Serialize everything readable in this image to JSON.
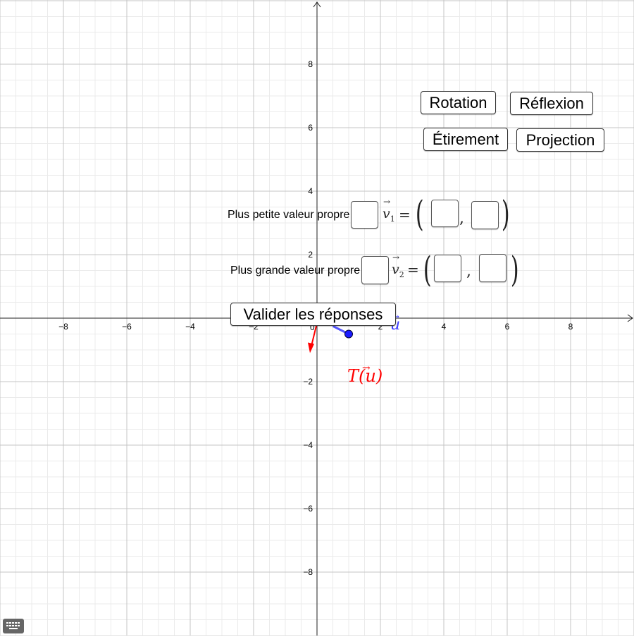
{
  "graph": {
    "x_range": [
      -10,
      10
    ],
    "y_range": [
      -10,
      10
    ],
    "x_ticks": [
      "−8",
      "−6",
      "−4",
      "−2",
      "2",
      "4",
      "6",
      "8"
    ],
    "y_ticks": [
      "8",
      "6",
      "4",
      "2",
      "−2",
      "−4",
      "−6",
      "−8"
    ],
    "origin_label": "0",
    "vector_u": {
      "end": [
        1,
        -0.5
      ],
      "label": "u",
      "color": "#3b3bff"
    },
    "vector_Tu": {
      "end": [
        -0.2,
        -1.1
      ],
      "label": "T(u)",
      "color": "#ff0000"
    },
    "grid": true
  },
  "buttons": {
    "rotation": "Rotation",
    "reflexion": "Réflexion",
    "etirement": "Étirement",
    "projection": "Projection",
    "valider": "Valider les réponses"
  },
  "rows": {
    "smallest_label": "Plus petite valeur propre",
    "largest_label": "Plus grande valeur propre",
    "v1_symbol": "v",
    "v1_sub": "1",
    "v2_symbol": "v",
    "v2_sub": "2",
    "equals": "=",
    "comma": ","
  },
  "inputs": {
    "lambda1": "",
    "v1x": "",
    "v1y": "",
    "lambda2": "",
    "v2x": "",
    "v2y": ""
  },
  "icons": {
    "keyboard": "keyboard-icon"
  }
}
